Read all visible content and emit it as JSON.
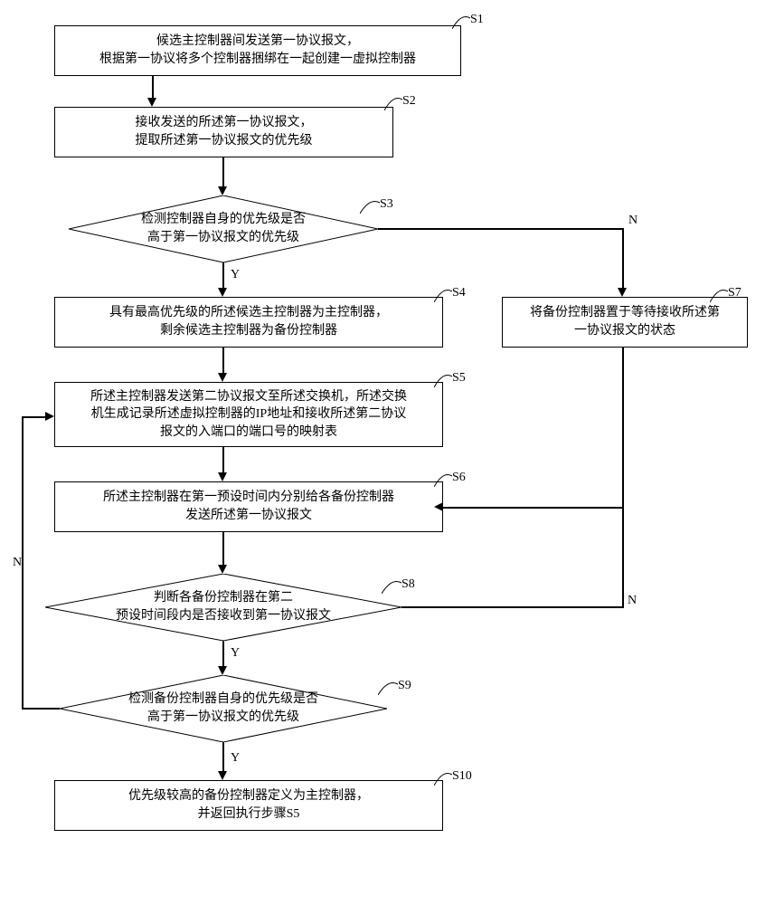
{
  "steps": {
    "s1": {
      "label": "S1",
      "text": "候选主控制器间发送第一协议报文，\n根据第一协议将多个控制器捆绑在一起创建一虚拟控制器"
    },
    "s2": {
      "label": "S2",
      "text": "接收发送的所述第一协议报文，\n提取所述第一协议报文的优先级"
    },
    "s3": {
      "label": "S3",
      "text": "检测控制器自身的优先级是否\n高于第一协议报文的优先级"
    },
    "s4": {
      "label": "S4",
      "text": "具有最高优先级的所述候选主控制器为主控制器，\n剩余候选主控制器为备份控制器"
    },
    "s5": {
      "label": "S5",
      "text": "所述主控制器发送第二协议报文至所述交换机，所述交换\n机生成记录所述虚拟控制器的IP地址和接收所述第二协议\n报文的入端口的端口号的映射表"
    },
    "s6": {
      "label": "S6",
      "text": "所述主控制器在第一预设时间内分别给各备份控制器\n发送所述第一协议报文"
    },
    "s7": {
      "label": "S7",
      "text": "将备份控制器置于等待接收所述第\n一协议报文的状态"
    },
    "s8": {
      "label": "S8",
      "text": "判断各备份控制器在第二\n预设时间段内是否接收到第一协议报文"
    },
    "s9": {
      "label": "S9",
      "text": "检测备份控制器自身的优先级是否\n高于第一协议报文的优先级"
    },
    "s10": {
      "label": "S10",
      "text": "优先级较高的备份控制器定义为主控制器，\n并返回执行步骤S5"
    }
  },
  "labels": {
    "yes": "Y",
    "no": "N"
  }
}
